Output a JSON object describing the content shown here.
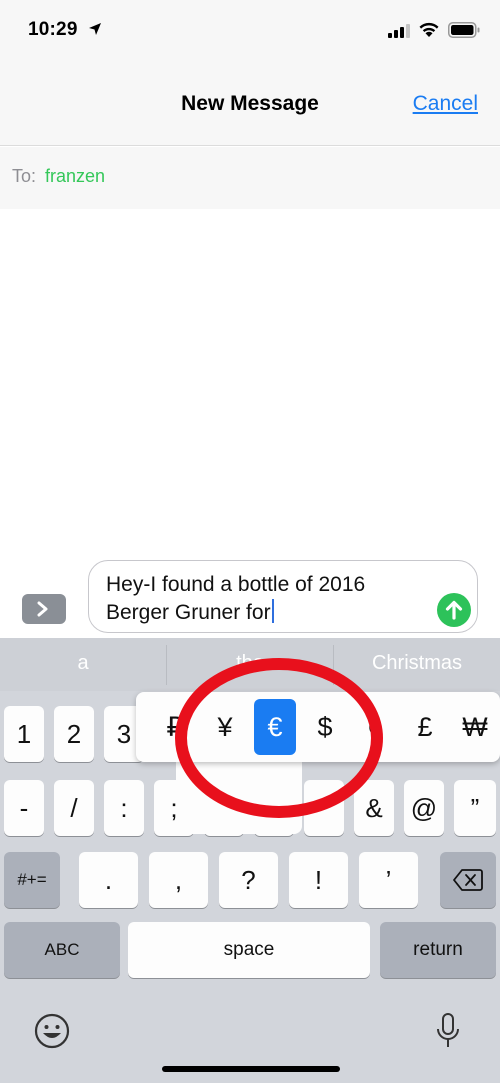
{
  "status": {
    "time": "10:29"
  },
  "nav": {
    "title": "New Message",
    "cancel": "Cancel"
  },
  "to": {
    "label": "To:",
    "recipient": "franzen"
  },
  "message": {
    "line1": "Hey-I found a bottle of 2016",
    "line2": "Berger Gruner for"
  },
  "predictions": [
    "a",
    "the",
    "Christmas"
  ],
  "keyboard": {
    "row1": [
      "1",
      "2",
      "3",
      "₽",
      "¥",
      "€",
      "$",
      "¢",
      "£",
      "₩"
    ],
    "row2": [
      "-",
      "/",
      ":",
      ";",
      "(",
      ")",
      "",
      "&",
      "@",
      "”"
    ],
    "row3": [
      ".",
      ",",
      "?",
      "!",
      "’"
    ],
    "shift_label": "#+=",
    "abc_label": "ABC",
    "space_label": "space",
    "return_label": "return",
    "currency_popup": [
      "₽",
      "¥",
      "€",
      "$",
      "¢",
      "£",
      "₩"
    ],
    "selected_currency": "€"
  },
  "colors": {
    "accent": "#1a7cf2",
    "recipient": "#34c759",
    "send": "#2dc25a",
    "annotation": "#e8101c"
  }
}
